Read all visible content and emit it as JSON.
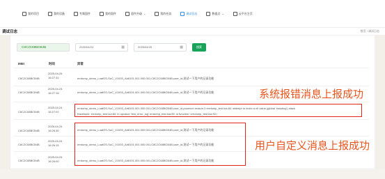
{
  "nav": {
    "items": [
      {
        "label": "我的项目",
        "active": false,
        "caret": false
      },
      {
        "label": "我的设备",
        "active": false,
        "caret": false
      },
      {
        "label": "专属固件",
        "active": false,
        "caret": false
      },
      {
        "label": "我的固件",
        "active": false,
        "caret": false
      },
      {
        "label": "固件升级",
        "active": false,
        "caret": true
      },
      {
        "label": "我的任务",
        "active": false,
        "caret": false
      },
      {
        "label": "调试日志",
        "active": true,
        "caret": false
      },
      {
        "label": "数据点",
        "active": false,
        "caret": true
      },
      {
        "label": "云平台主页",
        "active": false,
        "caret": false
      }
    ],
    "active_color": "#2a8ef0"
  },
  "page": {
    "title": "调试日志",
    "breadcrumb": "首页 / 调试日志"
  },
  "filters": {
    "imei_value": "C8C2C68BCB4B",
    "start_date": "2025/04/24",
    "end_date": "2025/04/25",
    "search_label": "搜索",
    "search_color": "#19a35a"
  },
  "table": {
    "headers": [
      "IMEI",
      "时间",
      "异常"
    ],
    "rows": [
      {
        "imei": "C8C2C68BCB4B",
        "time": "2025-04-24 16:27:31",
        "log": "errdump_demo_LuatOS-SoC_V1003_Air8101,001.000.001,C8C2C68BCB4B,user_id,测试一下用户的记录功能"
      },
      {
        "imei": "C8C2C68BCB4B",
        "time": "2025-04-24 16:27:16",
        "log": "errdump_demo_LuatOS-SoC_V1003_Air8101,001.000.001,C8C2C68BCB4B,user_id,测试一下用户的记录功能"
      },
      {
        "imei": "C8C2C68BCB4B",
        "time": "2025-04-24 16:27:01",
        "log": "errdump_demo_LuatOS-SoC_V1003_Air8101,001.000.001,C8C2C68BCB4B,user_id,poweron reason:3 errdump_test.lua:84: attempt to index a nil value (global 'ssssbug') stack",
        "log2": "traceback: errdump_test.lua:84: in upvalue 'test_error_log' errdump_test.lua:95: in function <errdump_test.lua:92>"
      },
      {
        "imei": "C8C2C68BCB4B",
        "time": "2025-04-24 16:26:30",
        "log": "errdump_demo_LuatOS-SoC_V1003_Air8101,001.000.001,C8C2C68BCB4B,user_id,测试一下用户的记录功能"
      },
      {
        "imei": "C8C2C68BCB4B",
        "time": "2025-04-24 16:26:15",
        "log": "errdump_demo_LuatOS-SoC_V1003_Air8101,001.000.001,C8C2C68BCB4B,user_id,测试一下用户的记录功能"
      },
      {
        "imei": "C8C2C68BCB4B",
        "time": "2025-04-24 16:26:00",
        "log": "errdump_demo_LuatOS-SoC_V1003_Air8101,001.000.001,C8C2C68BCB4B,user_id,测试一下用户的记录功能"
      }
    ]
  },
  "annotations": {
    "system_error": "系统报错消息上报成功",
    "user_defined": "用户自定义消息上报成功",
    "color": "#e8551e",
    "box_color": "#e2231a"
  }
}
